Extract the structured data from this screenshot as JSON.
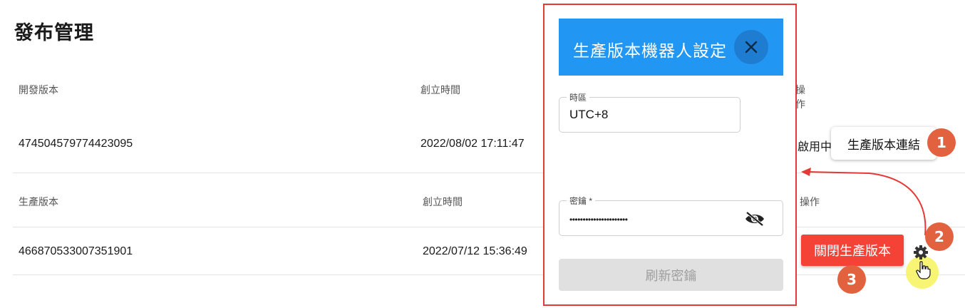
{
  "page": {
    "title": "發布管理"
  },
  "dev_table": {
    "headers": {
      "version": "開發版本",
      "created": "創立時間",
      "status": "",
      "actions": "操作"
    },
    "row": {
      "version": "474504579774423095",
      "created": "2022/08/02 17:11:47",
      "status": "啟用中"
    }
  },
  "prod_table": {
    "headers": {
      "version": "生產版本",
      "created": "創立時間",
      "actions": "操作"
    },
    "row": {
      "version": "466870533007351901",
      "created": "2022/07/12 15:36:49"
    }
  },
  "dialog": {
    "title": "生產版本機器人設定",
    "timezone": {
      "label": "時區",
      "value": "UTC+8"
    },
    "password": {
      "label": "密鑰 *",
      "value": "••••••••••••••••••••••"
    },
    "refresh_label": "刷新密鑰"
  },
  "actions": {
    "tooltip": "生產版本連結",
    "close_production_label": "關閉生產版本"
  },
  "badges": [
    "1",
    "2",
    "3"
  ],
  "colors": {
    "header_blue": "#2196f3",
    "danger_red": "#f44336",
    "badge_orange": "#e2623f",
    "highlight_yellow": "#f7f25c"
  }
}
